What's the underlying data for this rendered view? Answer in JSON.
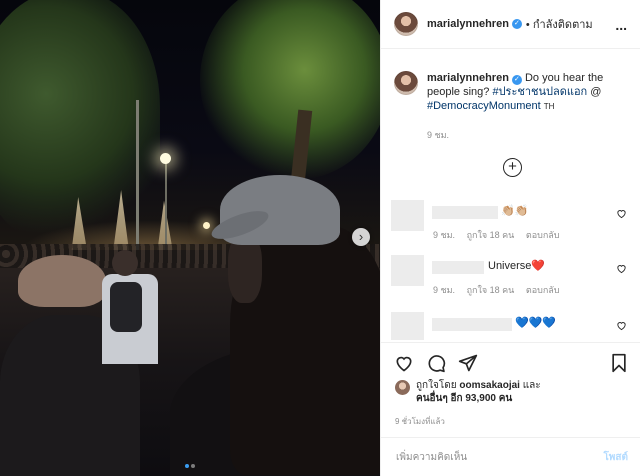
{
  "header": {
    "username": "marialynnehren",
    "follow_label": "• กำลังติดตาม",
    "more_label": "..."
  },
  "caption": {
    "username": "marialynnehren",
    "text": "Do you hear the people sing?",
    "tag1": "#ประชาชนปลดแอก",
    "mention": "@",
    "tag2": "#DemocracyMonument",
    "location_code": "TH",
    "time": "9 ชม."
  },
  "comments": [
    {
      "text": "",
      "emoji": "👏🏼👏🏼",
      "time": "9 ชม.",
      "likes": "ถูกใจ 18 คน",
      "reply": "ตอบกลับ"
    },
    {
      "text": "Universe",
      "emoji": "❤️",
      "time": "9 ชม.",
      "likes": "ถูกใจ 18 คน",
      "reply": "ตอบกลับ"
    },
    {
      "text": "",
      "emoji": "💙💙💙",
      "time": "",
      "likes": "",
      "reply": ""
    }
  ],
  "likes": {
    "prefix": "ถูกใจโดย",
    "user": "oomsakaojai",
    "and": "และ",
    "others": "คนอื่นๆ อีก 93,900 คน"
  },
  "posted_ago": "9 ชั่วโมงที่แล้ว",
  "add_comment": {
    "placeholder": "เพิ่มความคิดเห็น",
    "post_label": "โพสต์"
  },
  "carousel": {
    "current": 1,
    "total": 2
  },
  "colors": {
    "accent": "#3897f0",
    "link": "#003569",
    "muted": "#8e8e8e"
  },
  "icons": [
    "verified-icon",
    "more-icon",
    "load-more-icon",
    "heart-icon",
    "comment-icon",
    "share-icon",
    "bookmark-icon",
    "chevron-right-icon"
  ]
}
